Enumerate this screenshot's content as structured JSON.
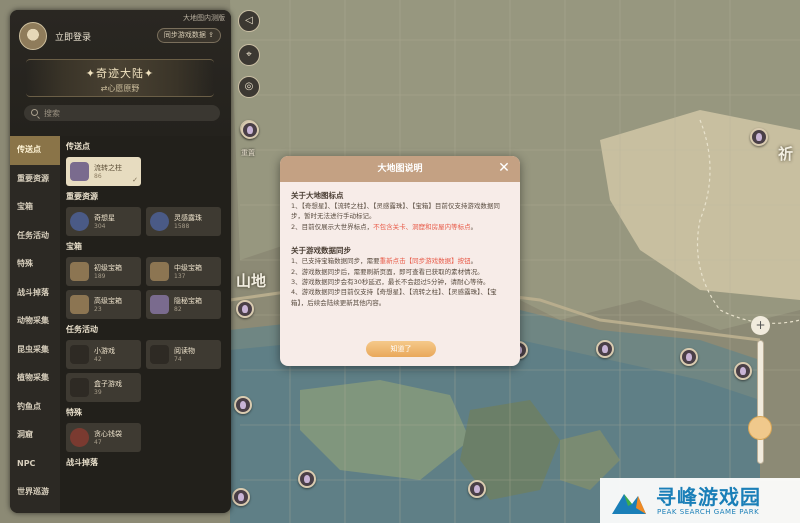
{
  "map": {
    "region_labels": [
      "山地",
      "祈"
    ]
  },
  "panel": {
    "top_note": "大地图内测版",
    "login_label": "立即登录",
    "sync_button": "同步游戏数据",
    "banner_title": "奇迹大陆",
    "banner_subtitle": "心愿原野",
    "search_placeholder": "搜索",
    "categories": [
      {
        "label": "传送点",
        "active": true
      },
      {
        "label": "重要资源",
        "active": false
      },
      {
        "label": "宝箱",
        "active": false
      },
      {
        "label": "任务活动",
        "active": false
      },
      {
        "label": "特殊",
        "active": false
      },
      {
        "label": "战斗掉落",
        "active": false
      },
      {
        "label": "动物采集",
        "active": false
      },
      {
        "label": "昆虫采集",
        "active": false
      },
      {
        "label": "植物采集",
        "active": false
      },
      {
        "label": "钓鱼点",
        "active": false
      },
      {
        "label": "洞窟",
        "active": false
      },
      {
        "label": "NPC",
        "active": false
      },
      {
        "label": "世界巡游",
        "active": false
      }
    ],
    "sections": {
      "teleport": {
        "title": "传送点",
        "items": [
          {
            "name": "流转之柱",
            "count": "86",
            "selected": true
          }
        ]
      },
      "resources": {
        "title": "重要资源",
        "items": [
          {
            "name": "奇想星",
            "count": "304"
          },
          {
            "name": "灵感露珠",
            "count": "1588"
          }
        ]
      },
      "chests": {
        "title": "宝箱",
        "items": [
          {
            "name": "初级宝箱",
            "count": "189"
          },
          {
            "name": "中级宝箱",
            "count": "137"
          },
          {
            "name": "高级宝箱",
            "count": "23"
          },
          {
            "name": "隐秘宝箱",
            "count": "82"
          }
        ]
      },
      "tasks": {
        "title": "任务活动",
        "items": [
          {
            "name": "小游戏",
            "count": "42"
          },
          {
            "name": "阅读物",
            "count": "74"
          },
          {
            "name": "盒子游戏",
            "count": "39"
          }
        ]
      },
      "special": {
        "title": "特殊",
        "items": [
          {
            "name": "贪心钱袋",
            "count": "47"
          }
        ]
      },
      "combat": {
        "title": "战斗掉落"
      }
    }
  },
  "tools": {
    "back_icon": "back-arrow-icon",
    "locate_icon": "location-pin-icon",
    "record_icon": "compass-icon",
    "reset_label": "重置"
  },
  "modal": {
    "title": "大地图说明",
    "sec1_title": "关于大地图标点",
    "sec1_p1_a": "1、【奇想星】、【流转之柱】、【灵感露珠】、【宝箱】目前仅支持游戏数据同步，暂时无法进行手动标记。",
    "sec1_p2_a": "2、目前仅展示大世界标点，",
    "sec1_p2_hi": "不包含关卡、洞窟和房屋内等标点",
    "sec1_p2_b": "。",
    "sec2_title": "关于游戏数据同步",
    "sec2_p1_a": "1、已支持宝箱数据同步，需要",
    "sec2_p1_hi": "重新点击【同步游戏数据】按钮",
    "sec2_p1_b": "。",
    "sec2_p2": "2、游戏数据同步后，需要刷新页面，即可查看已获取的素材情况。",
    "sec2_p3": "3、游戏数据同步会有30秒延迟，最长不会超过5分钟，请耐心等待。",
    "sec2_p4": "4、游戏数据同步目前仅支持【奇想星】、【流转之柱】、【灵感露珠】、【宝箱】，后续会陆续更新其他内容。",
    "ok_label": "知道了"
  },
  "watermark": {
    "title": "寻峰游戏园",
    "subtitle": "PEAK SEARCH GAME PARK"
  },
  "colors": {
    "accent": "#8a7448",
    "modal_header": "#c4a183",
    "highlight": "#e85b49",
    "button": "#e9a85a",
    "watermark": "#1a7fb8"
  }
}
